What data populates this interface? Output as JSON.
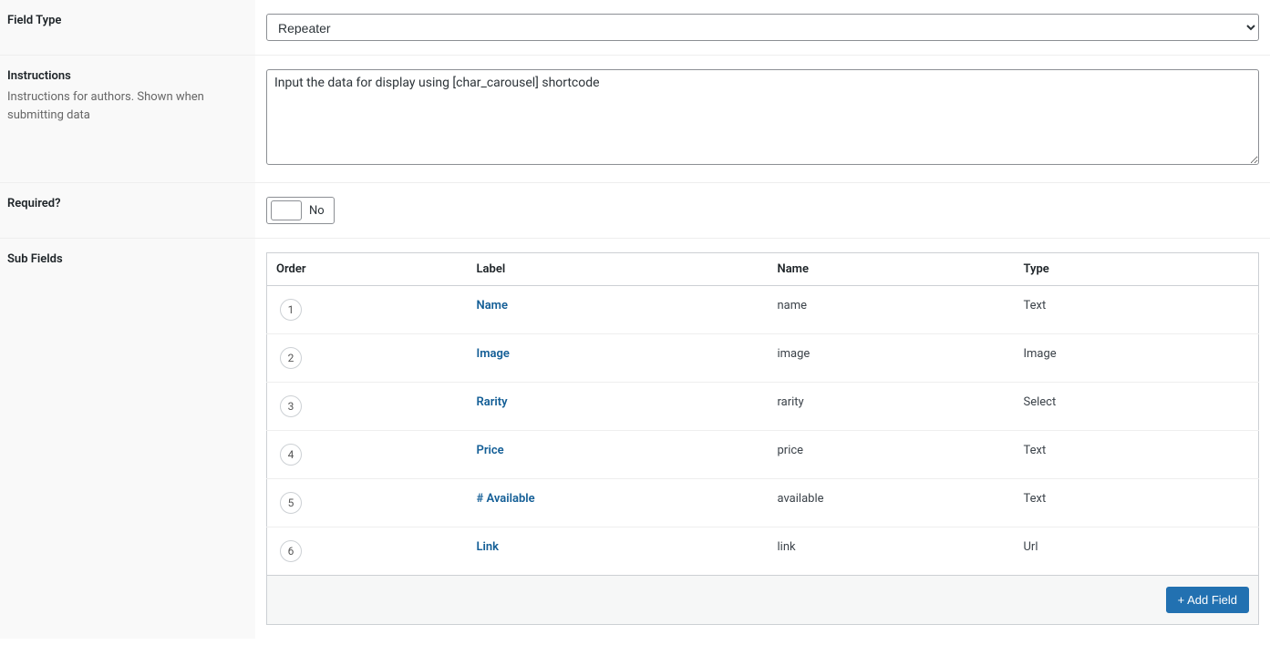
{
  "rows": {
    "fieldType": {
      "title": "Field Type",
      "value": "Repeater"
    },
    "instructions": {
      "title": "Instructions",
      "desc": "Instructions for authors. Shown when submitting data",
      "value": "Input the data for display using [char_carousel] shortcode"
    },
    "required": {
      "title": "Required?",
      "value": "No"
    },
    "subFields": {
      "title": "Sub Fields",
      "headers": {
        "order": "Order",
        "label": "Label",
        "name": "Name",
        "type": "Type"
      },
      "rows": [
        {
          "order": "1",
          "label": "Name",
          "name": "name",
          "type": "Text"
        },
        {
          "order": "2",
          "label": "Image",
          "name": "image",
          "type": "Image"
        },
        {
          "order": "3",
          "label": "Rarity",
          "name": "rarity",
          "type": "Select"
        },
        {
          "order": "4",
          "label": "Price",
          "name": "price",
          "type": "Text"
        },
        {
          "order": "5",
          "label": "# Available",
          "name": "available",
          "type": "Text"
        },
        {
          "order": "6",
          "label": "Link",
          "name": "link",
          "type": "Url"
        }
      ],
      "addField": "+ Add Field"
    }
  }
}
